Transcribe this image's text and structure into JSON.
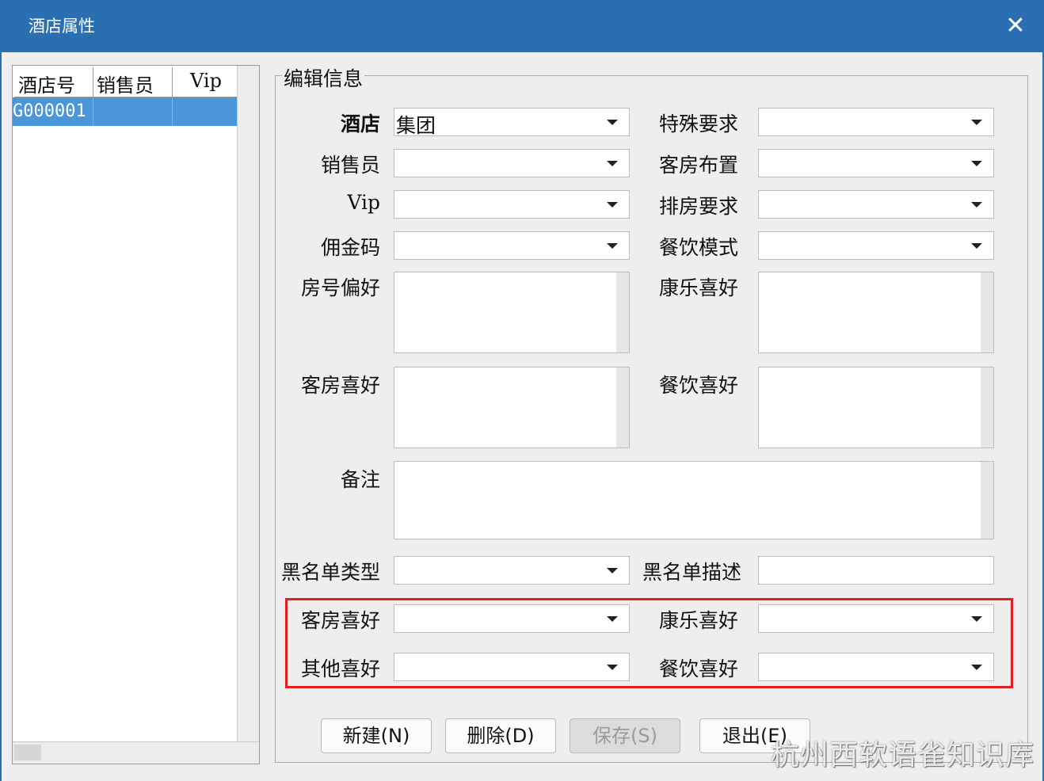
{
  "window": {
    "title": "酒店属性"
  },
  "grid": {
    "columns": [
      "酒店号",
      "销售员",
      "Vip"
    ],
    "rows": [
      [
        "G000001",
        "",
        ""
      ]
    ]
  },
  "form": {
    "group_title": "编辑信息",
    "labels": {
      "hotel": "酒店",
      "salesperson": "销售员",
      "vip": "Vip",
      "commission_code": "佣金码",
      "room_no_pref": "房号偏好",
      "room_pref": "客房喜好",
      "remark": "备注",
      "blacklist_type": "黑名单类型",
      "special_req": "特殊要求",
      "room_layout": "客房布置",
      "room_assign_req": "排房要求",
      "dining_mode": "餐饮模式",
      "recreation_pref": "康乐喜好",
      "dining_pref": "餐饮喜好",
      "blacklist_desc": "黑名单描述",
      "room_pref2": "客房喜好",
      "other_pref": "其他喜好",
      "recreation_pref2": "康乐喜好",
      "dining_pref2": "餐饮喜好"
    },
    "values": {
      "hotel": "集团"
    }
  },
  "buttons": {
    "new": "新建(N)",
    "delete": "删除(D)",
    "save": "保存(S)",
    "exit": "退出(E)"
  },
  "watermark": "杭州西软语雀知识库",
  "colors": {
    "titlebar": "#2b6fb3",
    "selection": "#4a96d8",
    "highlight": "#e02020"
  }
}
